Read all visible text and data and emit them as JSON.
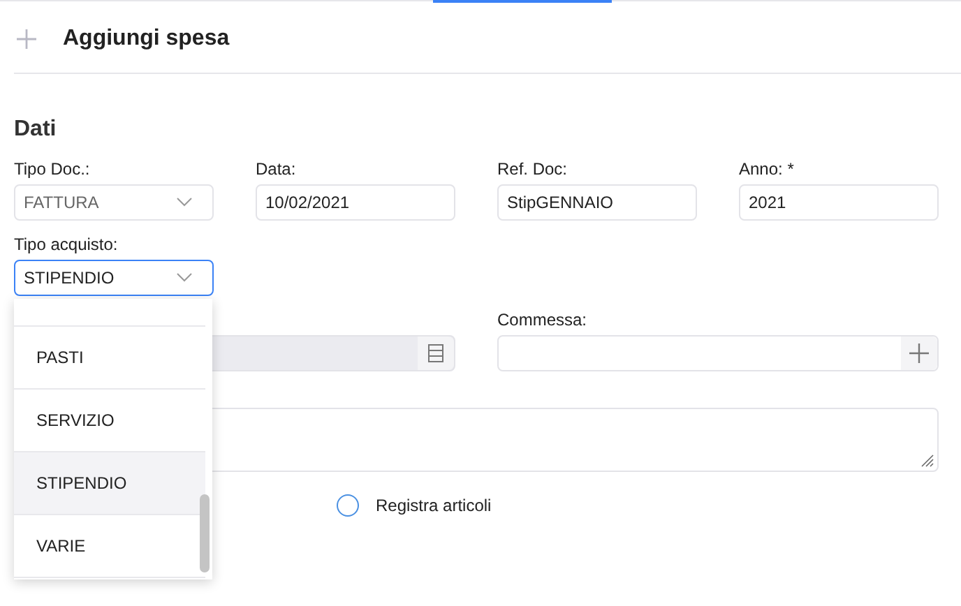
{
  "header": {
    "title": "Aggiungi spesa"
  },
  "section": {
    "title": "Dati"
  },
  "fields": [
    {
      "label": "Tipo Doc.:",
      "kind": "select",
      "value": "FATTURA"
    },
    {
      "label": "Data:",
      "kind": "text",
      "value": "10/02/2021"
    },
    {
      "label": "Ref. Doc:",
      "kind": "text",
      "value": "StipGENNAIO"
    },
    {
      "label": "Anno: *",
      "kind": "text",
      "value": "2021"
    }
  ],
  "tipo_acquisto": {
    "label": "Tipo acquisto:",
    "value": "STIPENDIO",
    "expanded": true,
    "options": [
      {
        "selected": false
      },
      {
        "label": "PASTI",
        "selected": false
      },
      {
        "label": "SERVIZIO",
        "selected": false
      },
      {
        "label": "STIPENDIO",
        "selected": true
      },
      {
        "label": "VARIE",
        "selected": false
      }
    ]
  },
  "commessa": {
    "label": "Commessa:"
  },
  "registra_articoli": {
    "label": "Registra articoli",
    "checked": false
  }
}
